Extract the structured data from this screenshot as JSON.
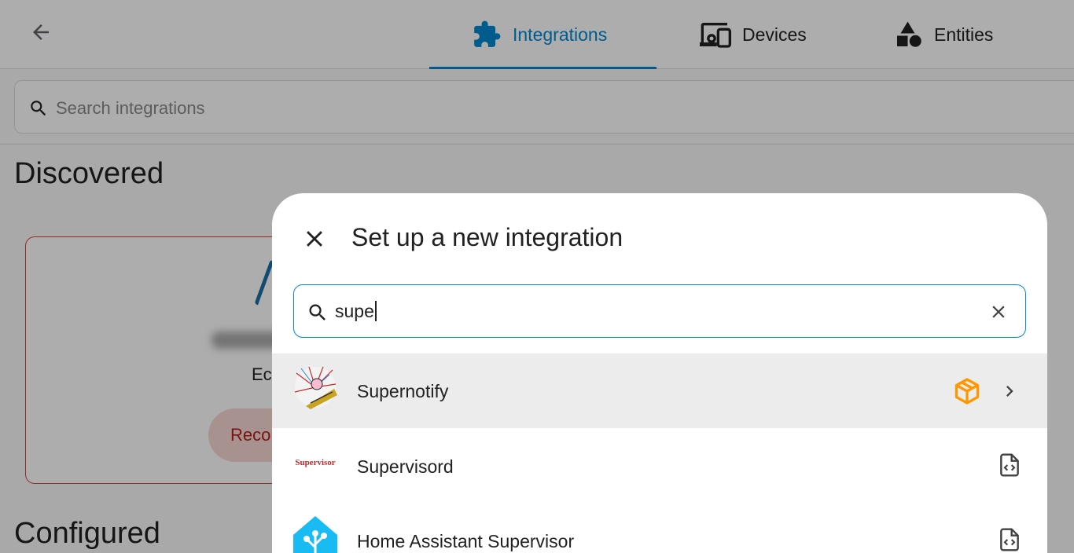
{
  "header": {
    "tabs": [
      {
        "label": "Integrations",
        "icon": "puzzle-icon",
        "active": true
      },
      {
        "label": "Devices",
        "icon": "devices-icon",
        "active": false
      },
      {
        "label": "Entities",
        "icon": "shapes-icon",
        "active": false
      }
    ]
  },
  "search": {
    "placeholder": "Search integrations"
  },
  "sections": {
    "discovered": "Discovered",
    "configured": "Configured"
  },
  "discovered_card": {
    "name_partial": "Ec",
    "button_partial": "Reco"
  },
  "dialog": {
    "title": "Set up a new integration",
    "search_value": "supe",
    "results": [
      {
        "label": "Supernotify",
        "badge": "custom-integration-icon",
        "badge_color": "#ff9800",
        "highlighted": true
      },
      {
        "label": "Supervisord",
        "logo_text": "Supervisor",
        "badge": "yaml-config-icon"
      },
      {
        "label": "Home Assistant Supervisor",
        "badge": "yaml-config-icon"
      }
    ]
  },
  "colors": {
    "accent": "#0288d1",
    "error": "#db4437",
    "custom_badge": "#ff9800",
    "ha_blue": "#18bcf2"
  }
}
